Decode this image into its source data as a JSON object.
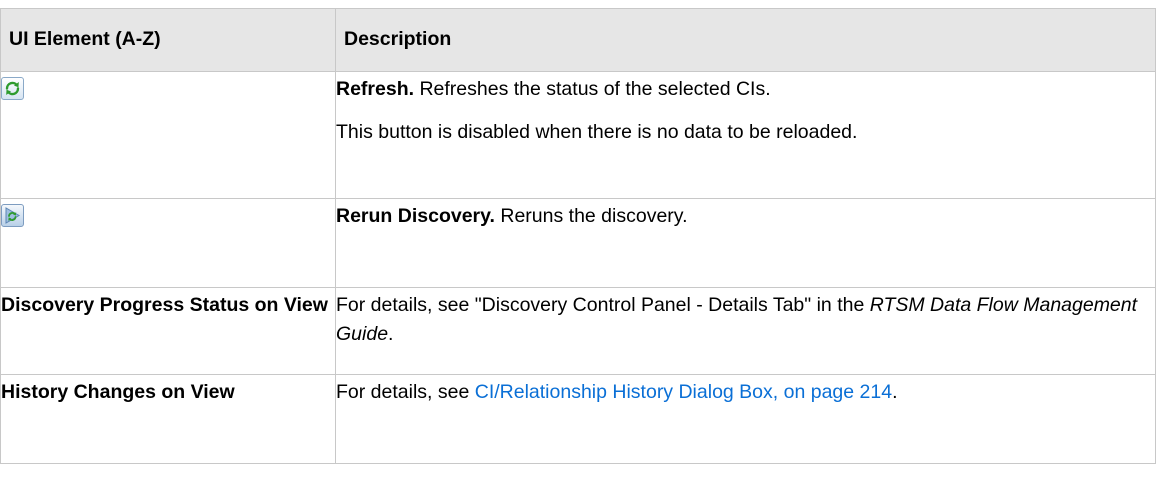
{
  "table": {
    "headers": [
      "UI Element (A-Z)",
      "Description"
    ],
    "rows": [
      {
        "element_icon": "refresh-icon",
        "description_term": "Refresh.",
        "description_text": " Refreshes the status of the selected CIs.",
        "description_note": "This button is disabled when there is no data to be reloaded."
      },
      {
        "element_icon": "rerun-discovery-icon",
        "description_term": "Rerun Discovery.",
        "description_text": " Reruns the discovery."
      },
      {
        "element_name": "Discovery Progress Status on View",
        "description_pre": "For details, see \"Discovery Control Panel - Details Tab\" in the ",
        "description_italic": "RTSM Data Flow Management Guide",
        "description_post": "."
      },
      {
        "element_name": "History Changes on View",
        "description_pre": "For details, see ",
        "description_link": "CI/Relationship History Dialog Box, on page 214",
        "description_post": "."
      }
    ]
  },
  "colors": {
    "header_bg": "#e6e6e6",
    "border": "#c8c8c8",
    "link": "#0a6fd6",
    "refresh_green": "#2e9b2e"
  }
}
